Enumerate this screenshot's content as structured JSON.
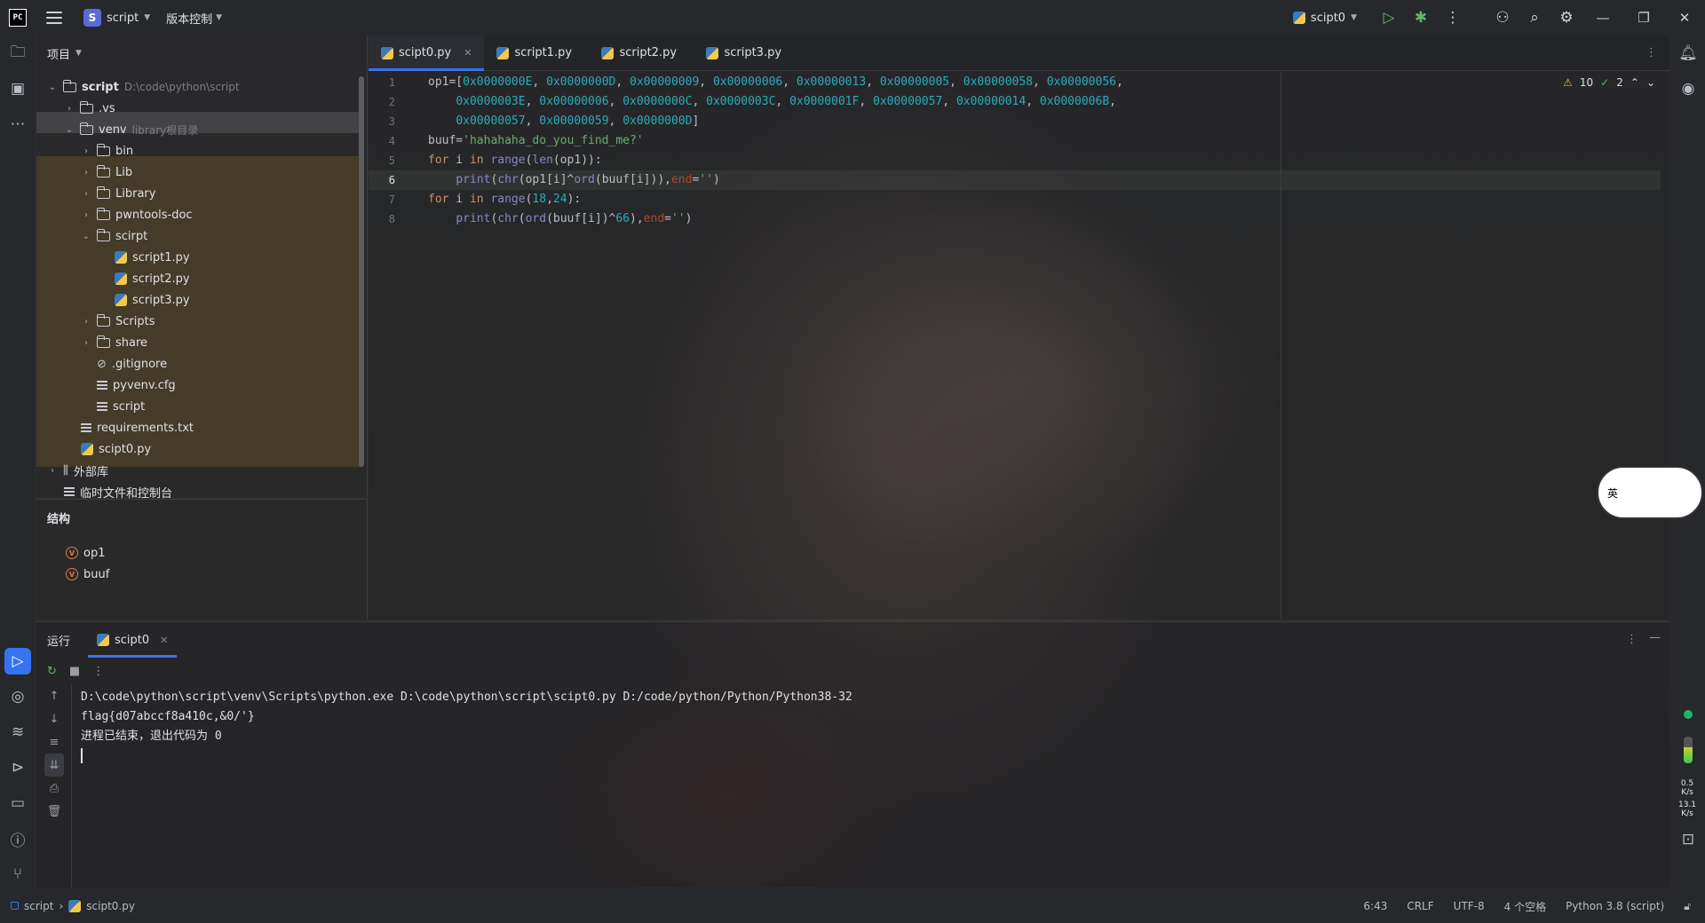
{
  "titlebar": {
    "logo": "PC",
    "project_initial": "S",
    "project_name": "script",
    "vcs_label": "版本控制",
    "run_config": "scipt0"
  },
  "project_panel": {
    "title": "项目",
    "root_name": "script",
    "root_path": "D:\\code\\python\\script",
    "items": [
      {
        "label": ".vs"
      },
      {
        "label": "venv",
        "hint": "library根目录"
      },
      {
        "label": "bin"
      },
      {
        "label": "Lib"
      },
      {
        "label": "Library"
      },
      {
        "label": "pwntools-doc"
      },
      {
        "label": "scirpt"
      },
      {
        "label": "script1.py"
      },
      {
        "label": "script2.py"
      },
      {
        "label": "script3.py"
      },
      {
        "label": "Scripts"
      },
      {
        "label": "share"
      },
      {
        "label": ".gitignore"
      },
      {
        "label": "pyvenv.cfg"
      },
      {
        "label": "script"
      },
      {
        "label": "requirements.txt"
      },
      {
        "label": "scipt0.py"
      },
      {
        "label": "外部库"
      },
      {
        "label": "临时文件和控制台"
      }
    ]
  },
  "structure": {
    "title": "结构",
    "items": [
      "op1",
      "buuf"
    ]
  },
  "editor": {
    "tabs": [
      "scipt0.py",
      "script1.py",
      "script2.py",
      "script3.py"
    ],
    "active_tab": "scipt0.py",
    "line_numbers": [
      "1",
      "2",
      "3",
      "4",
      "5",
      "6",
      "7",
      "8"
    ],
    "warnings": "10",
    "checks": "2"
  },
  "run": {
    "title": "运行",
    "tab": "scipt0",
    "console": [
      "D:\\code\\python\\script\\venv\\Scripts\\python.exe D:\\code\\python\\script\\scipt0.py D:/code/python/Python/Python38-32",
      "flag{d07abccf8a410c,&0/'}",
      "进程已结束，退出代码为 0"
    ]
  },
  "statusbar": {
    "crumb_project": "script",
    "crumb_file": "scipt0.py",
    "position": "6:43",
    "line_sep": "CRLF",
    "encoding": "UTF-8",
    "indent": "4 个空格",
    "interpreter": "Python 3.8 (script)"
  },
  "net": {
    "up": "0.5",
    "up_unit": "K/s",
    "down": "13.1",
    "down_unit": "K/s"
  },
  "sticker_text": "英",
  "colors": {
    "accent": "#3574f0",
    "keyword": "#cf8e6d",
    "number": "#2aacb8",
    "string": "#6aab73",
    "function": "#56a8f5"
  }
}
